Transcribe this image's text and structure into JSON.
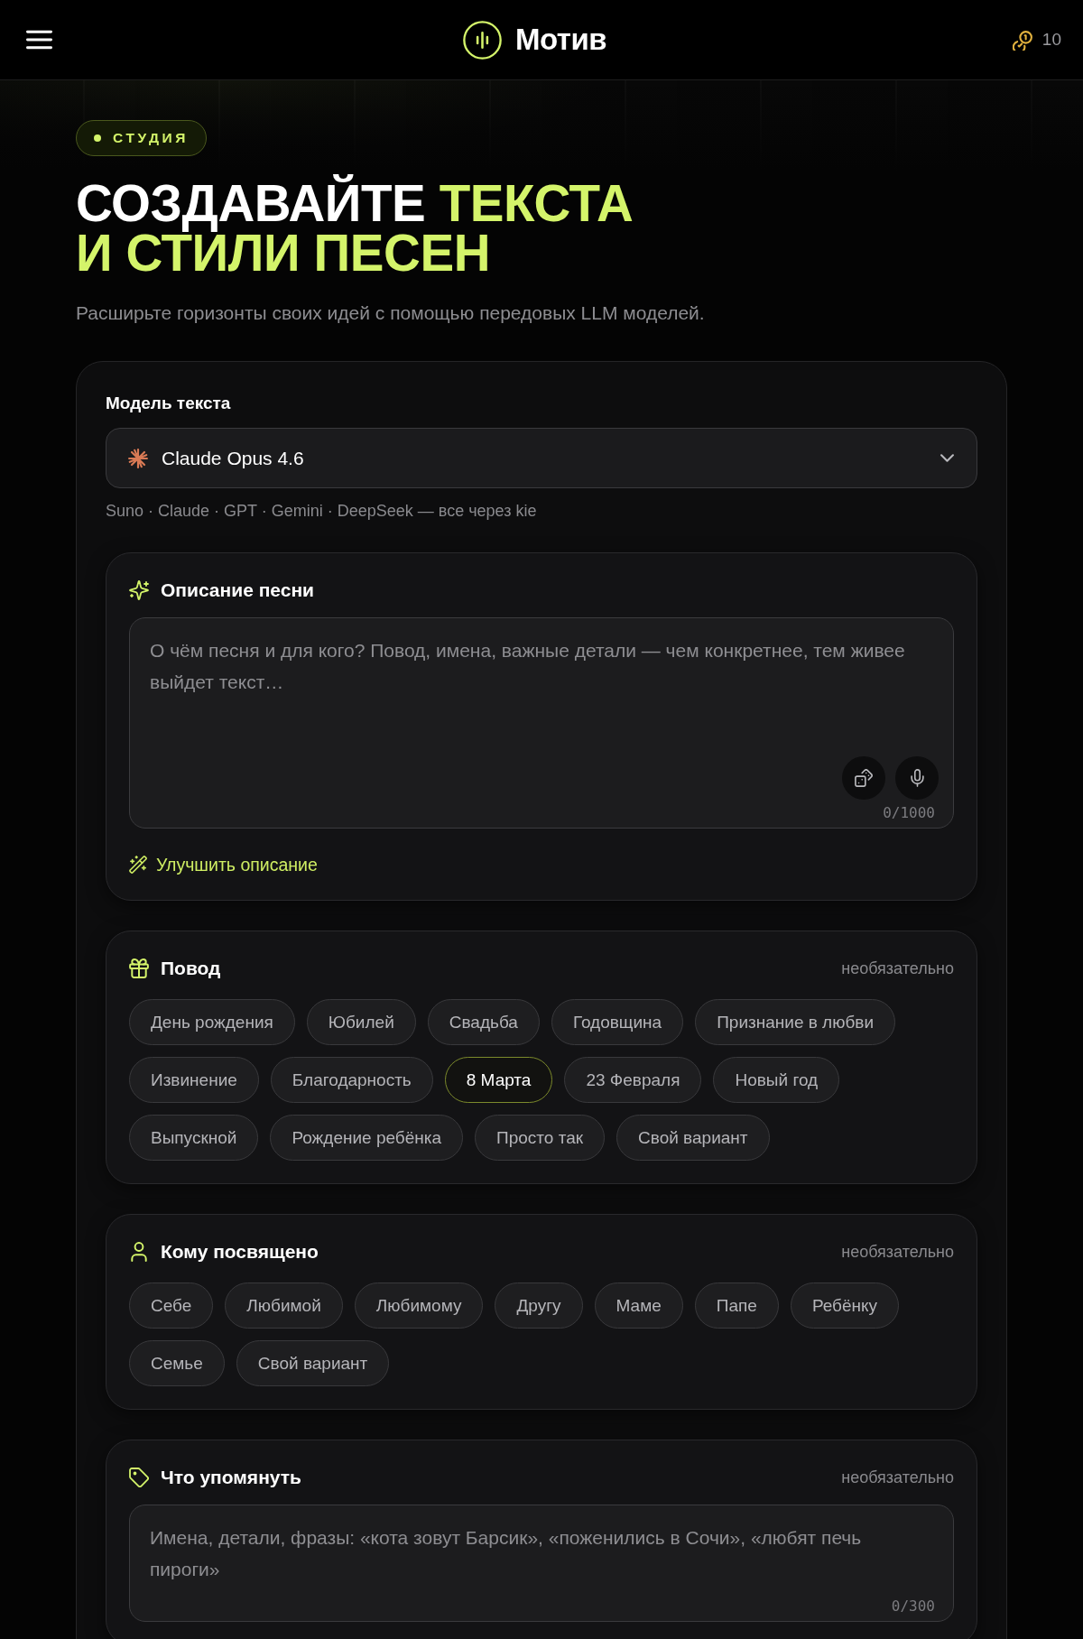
{
  "header": {
    "logo": "Мотив",
    "credits": "10"
  },
  "hero": {
    "badge": "СТУДИЯ",
    "title_lines": [
      [
        {
          "text": "СОЗДАВАЙТЕ",
          "accent": false
        },
        {
          "text": "ТЕКСТА",
          "accent": true
        }
      ],
      [
        {
          "text": "И СТИЛИ ПЕСЕН",
          "accent": true
        }
      ]
    ],
    "subtitle": "Расширьте горизонты своих идей с помощью передовых LLM моделей."
  },
  "model": {
    "label": "Модель текста",
    "select": {
      "value": "Claude Opus 4.6"
    },
    "hint": "Suno · Claude · GPT · Gemini · DeepSeek — все через kie"
  },
  "sections": [
    {
      "kind": "text",
      "title": "Описание песни",
      "field": {
        "placeholder": "О чём песня и для кого? Повод, имена, важные детали — чем конкретнее, тем живее выйдет текст…",
        "counter": "0/1000",
        "tools": true
      },
      "action": "Улучшить описание"
    },
    {
      "kind": "chips",
      "title": "Повод",
      "note": "необязательно",
      "chips": [
        {
          "label": "День рождения",
          "selected": false
        },
        {
          "label": "Юбилей",
          "selected": false
        },
        {
          "label": "Свадьба",
          "selected": false
        },
        {
          "label": "Годовщина",
          "selected": false
        },
        {
          "label": "Признание в любви",
          "selected": false
        },
        {
          "label": "Извинение",
          "selected": false
        },
        {
          "label": "Благодарность",
          "selected": false
        },
        {
          "label": "8 Марта",
          "selected": true
        },
        {
          "label": "23 Февраля",
          "selected": false
        },
        {
          "label": "Новый год",
          "selected": false
        },
        {
          "label": "Выпускной",
          "selected": false
        },
        {
          "label": "Рождение ребёнка",
          "selected": false
        },
        {
          "label": "Просто так",
          "selected": false
        },
        {
          "label": "Свой вариант",
          "selected": false
        }
      ]
    },
    {
      "kind": "chips",
      "title": "Кому посвящено",
      "note": "необязательно",
      "chips": [
        {
          "label": "Себе",
          "selected": false
        },
        {
          "label": "Любимой",
          "selected": false
        },
        {
          "label": "Любимому",
          "selected": false
        },
        {
          "label": "Другу",
          "selected": false
        },
        {
          "label": "Маме",
          "selected": false
        },
        {
          "label": "Папе",
          "selected": false
        },
        {
          "label": "Ребёнку",
          "selected": false
        },
        {
          "label": "Семье",
          "selected": false
        },
        {
          "label": "Свой вариант",
          "selected": false
        }
      ]
    },
    {
      "kind": "text",
      "title": "Что упомянуть",
      "note": "необязательно",
      "field": {
        "placeholder": "Имена, детали, фразы: «кота зовут Барсик», «поженились в Сочи», «любят печь пироги»",
        "counter": "0/300"
      }
    }
  ]
}
